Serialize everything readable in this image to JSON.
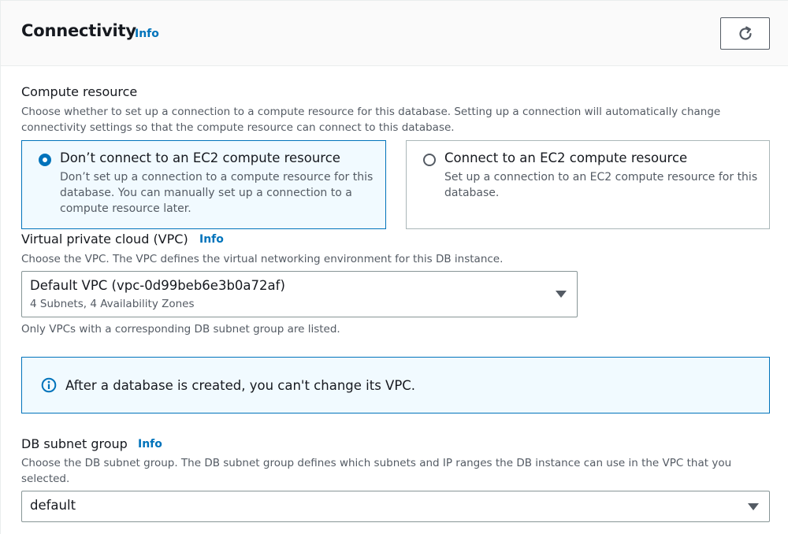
{
  "header": {
    "title": "Connectivity",
    "info": "Info",
    "refresh_icon": "refresh-icon"
  },
  "compute": {
    "label": "Compute resource",
    "description": "Choose whether to set up a connection to a compute resource for this database. Setting up a connection will automatically change connectivity settings so that the compute resource can connect to this database.",
    "options": [
      {
        "title": "Don’t connect to an EC2 compute resource",
        "description": "Don’t set up a connection to a compute resource for this database. You can manually set up a connection to a compute resource later.",
        "selected": true
      },
      {
        "title": "Connect to an EC2 compute resource",
        "description": "Set up a connection to an EC2 compute resource for this database.",
        "selected": false
      }
    ]
  },
  "vpc": {
    "label": "Virtual private cloud (VPC)",
    "info": "Info",
    "description": "Choose the VPC. The VPC defines the virtual networking environment for this DB instance.",
    "selected_value": "Default VPC (vpc-0d99beb6e3b0a72af)",
    "selected_detail": "4 Subnets, 4 Availability Zones",
    "hint": "Only VPCs with a corresponding DB subnet group are listed."
  },
  "alert": {
    "icon": "info-circle-icon",
    "text": "After a database is created, you can't change its VPC."
  },
  "subnet": {
    "label": "DB subnet group",
    "info": "Info",
    "description": "Choose the DB subnet group. The DB subnet group defines which subnets and IP ranges the DB instance can use in the VPC that you selected.",
    "selected_value": "default"
  },
  "colors": {
    "accent": "#0073bb",
    "selected_bg": "#f1faff",
    "text": "#16191f",
    "secondary_text": "#545b64"
  }
}
